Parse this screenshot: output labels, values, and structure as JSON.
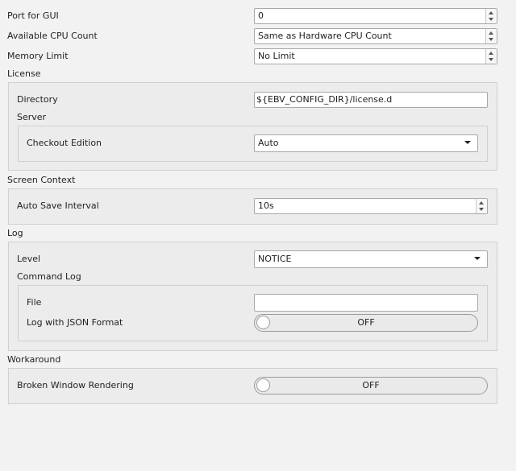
{
  "general": {
    "port_label": "Port for GUI",
    "port_value": "0",
    "cpu_label": "Available CPU Count",
    "cpu_value": "Same as Hardware CPU Count",
    "memory_label": "Memory Limit",
    "memory_value": "No Limit"
  },
  "license": {
    "title": "License",
    "directory_label": "Directory",
    "directory_value": "${EBV_CONFIG_DIR}/license.d",
    "server": {
      "title": "Server",
      "checkout_label": "Checkout Edition",
      "checkout_value": "Auto"
    }
  },
  "screen_context": {
    "title": "Screen Context",
    "autosave_label": "Auto Save Interval",
    "autosave_value": "10s"
  },
  "log": {
    "title": "Log",
    "level_label": "Level",
    "level_value": "NOTICE",
    "command_log": {
      "title": "Command Log",
      "file_label": "File",
      "file_value": "",
      "json_label": "Log with JSON Format",
      "json_state": "OFF"
    }
  },
  "workaround": {
    "title": "Workaround",
    "broken_label": "Broken Window Rendering",
    "broken_state": "OFF"
  }
}
